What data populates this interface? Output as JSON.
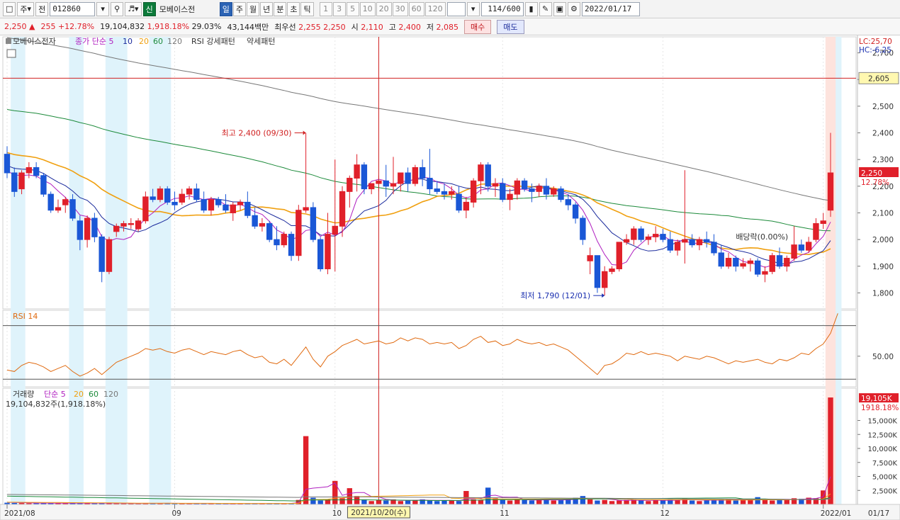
{
  "toolbar": {
    "mode_label": "주",
    "prev_label": "전",
    "code": "012860",
    "credit_badge": "신",
    "stock_name": "모베이스전",
    "periods": [
      "일",
      "주",
      "월",
      "년",
      "분",
      "초",
      "틱"
    ],
    "active_period": "일",
    "intervals": [
      "1",
      "3",
      "5",
      "10",
      "20",
      "30",
      "60",
      "120"
    ],
    "count_value": "114",
    "count_max": "/600",
    "date": "2022/01/17"
  },
  "quote": {
    "price": "2,250",
    "arrow": "▲",
    "change": "255",
    "change_pct": "+12.78%",
    "volume": "19,104,832",
    "volume_ratio": "1,918.18%",
    "turnover": "29.03%",
    "amount": "43,144백만",
    "best_label": "최우선",
    "best_ask": "2,255",
    "best_bid": "2,250",
    "open_label": "시",
    "open": "2,110",
    "high_label": "고",
    "high": "2,400",
    "low_label": "저",
    "low": "2,085",
    "buy_label": "매수",
    "sell_label": "매도"
  },
  "price_panel": {
    "legend": {
      "name": "모베이스전자",
      "ma_label": "종가 단순",
      "ma_periods": [
        "5",
        "10",
        "20",
        "60",
        "120"
      ],
      "rsi_pattern": "RSI 강세패턴",
      "weak_pattern": "약세패턴"
    },
    "lc": "LC:25,70",
    "hc": "HC:-6,25",
    "high_marker": "최고 2,400 (09/30)",
    "low_marker": "최저 1,790 (12/01)",
    "dividend_marker": "배당락(0.00%)",
    "h_line_label": "2,605",
    "current_label": "2,250",
    "current_pct": "12.78%",
    "y_ticks": [
      "2,700",
      "2,600",
      "2,500",
      "2,400",
      "2,300",
      "2,200",
      "2,100",
      "2,000",
      "1,900",
      "1,800"
    ]
  },
  "rsi_panel": {
    "title": "RSI 14",
    "y_tick": "50.00"
  },
  "volume_panel": {
    "legend_title": "거래량",
    "ma_label": "단순",
    "ma_periods": [
      "5",
      "20",
      "60",
      "120"
    ],
    "summary": "19,104,832주(1,918.18%)",
    "current_label": "19,105K",
    "current_pct": "1918.18%",
    "y_ticks": [
      "15,000K",
      "12,500K",
      "10,000K",
      "7,500K",
      "5,000K",
      "2,500K"
    ]
  },
  "x_axis": {
    "labels": [
      "2021/08",
      "09",
      "10",
      "11",
      "12",
      "2022/01"
    ],
    "cursor_label": "2021/10/20(수)",
    "right_label": "01/17"
  },
  "colors": {
    "up": "#e0202a",
    "down": "#1a57d6",
    "ma5": "#b020c0",
    "ma10": "#1a2a9c",
    "ma20": "#f0a010",
    "ma60": "#1c8a3a",
    "ma120": "#777777"
  },
  "chart_data": {
    "type": "candlestick",
    "ylim": [
      1740,
      2760
    ],
    "candles": [
      [
        2320,
        2350,
        2230,
        2250
      ],
      [
        2250,
        2270,
        2160,
        2180
      ],
      [
        2190,
        2260,
        2170,
        2250
      ],
      [
        2250,
        2290,
        2230,
        2270
      ],
      [
        2270,
        2290,
        2230,
        2240
      ],
      [
        2240,
        2250,
        2160,
        2170
      ],
      [
        2170,
        2180,
        2100,
        2110
      ],
      [
        2110,
        2150,
        2100,
        2120
      ],
      [
        2130,
        2160,
        2100,
        2150
      ],
      [
        2150,
        2170,
        2070,
        2080
      ],
      [
        2070,
        2090,
        1960,
        2000
      ],
      [
        2000,
        2090,
        1970,
        2080
      ],
      [
        2080,
        2100,
        1990,
        2010
      ],
      [
        2010,
        2020,
        1840,
        1880
      ],
      [
        1880,
        2010,
        1870,
        2000
      ],
      [
        2030,
        2060,
        2010,
        2050
      ],
      [
        2050,
        2070,
        2030,
        2060
      ],
      [
        2060,
        2080,
        2040,
        2060
      ],
      [
        2040,
        2080,
        2030,
        2070
      ],
      [
        2070,
        2180,
        2060,
        2160
      ],
      [
        2160,
        2190,
        2140,
        2150
      ],
      [
        2150,
        2200,
        2140,
        2190
      ],
      [
        2190,
        2200,
        2130,
        2140
      ],
      [
        2140,
        2180,
        2110,
        2130
      ],
      [
        2140,
        2190,
        2130,
        2170
      ],
      [
        2170,
        2200,
        2150,
        2190
      ],
      [
        2190,
        2210,
        2140,
        2150
      ],
      [
        2150,
        2180,
        2100,
        2110
      ],
      [
        2110,
        2160,
        2090,
        2150
      ],
      [
        2150,
        2160,
        2120,
        2130
      ],
      [
        2130,
        2170,
        2100,
        2110
      ],
      [
        2100,
        2140,
        2070,
        2130
      ],
      [
        2130,
        2150,
        2110,
        2140
      ],
      [
        2140,
        2180,
        2080,
        2090
      ],
      [
        2090,
        2120,
        2040,
        2050
      ],
      [
        2050,
        2080,
        2030,
        2060
      ],
      [
        2060,
        2070,
        1990,
        2000
      ],
      [
        2000,
        2050,
        1960,
        1980
      ],
      [
        1980,
        2030,
        1970,
        2020
      ],
      [
        2020,
        2030,
        1920,
        1940
      ],
      [
        1940,
        2130,
        1920,
        2110
      ],
      [
        2110,
        2400,
        2100,
        2120
      ],
      [
        2120,
        2140,
        1990,
        2000
      ],
      [
        2000,
        2010,
        1880,
        1890
      ],
      [
        1890,
        2100,
        1870,
        2020
      ],
      [
        2020,
        2300,
        1880,
        2050
      ],
      [
        2050,
        2200,
        2010,
        2180
      ],
      [
        2180,
        2240,
        2120,
        2230
      ],
      [
        2230,
        2320,
        2180,
        2280
      ],
      [
        2280,
        2290,
        2170,
        2190
      ],
      [
        2190,
        2210,
        2170,
        2210
      ],
      [
        2210,
        2240,
        2180,
        2220
      ],
      [
        2220,
        2280,
        2160,
        2200
      ],
      [
        2200,
        2310,
        2170,
        2210
      ],
      [
        2210,
        2250,
        2180,
        2250
      ],
      [
        2250,
        2270,
        2180,
        2210
      ],
      [
        2210,
        2280,
        2200,
        2270
      ],
      [
        2270,
        2300,
        2200,
        2230
      ],
      [
        2230,
        2340,
        2170,
        2190
      ],
      [
        2190,
        2220,
        2170,
        2180
      ],
      [
        2180,
        2210,
        2150,
        2170
      ],
      [
        2170,
        2200,
        2150,
        2180
      ],
      [
        2170,
        2200,
        2100,
        2110
      ],
      [
        2110,
        2160,
        2080,
        2140
      ],
      [
        2140,
        2230,
        2120,
        2220
      ],
      [
        2220,
        2290,
        2170,
        2280
      ],
      [
        2280,
        2290,
        2180,
        2200
      ],
      [
        2200,
        2230,
        2160,
        2210
      ],
      [
        2210,
        2230,
        2140,
        2150
      ],
      [
        2150,
        2190,
        2110,
        2170
      ],
      [
        2170,
        2230,
        2150,
        2220
      ],
      [
        2220,
        2230,
        2180,
        2190
      ],
      [
        2190,
        2210,
        2140,
        2180
      ],
      [
        2180,
        2210,
        2160,
        2200
      ],
      [
        2200,
        2230,
        2150,
        2170
      ],
      [
        2170,
        2200,
        2160,
        2190
      ],
      [
        2190,
        2200,
        2140,
        2150
      ],
      [
        2150,
        2170,
        2110,
        2130
      ],
      [
        2130,
        2140,
        2060,
        2080
      ],
      [
        2080,
        2090,
        1980,
        2000
      ],
      [
        1920,
        1970,
        1870,
        1940
      ],
      [
        1940,
        1940,
        1800,
        1820
      ],
      [
        1820,
        1900,
        1790,
        1880
      ],
      [
        1880,
        1900,
        1870,
        1890
      ],
      [
        1890,
        1990,
        1880,
        1990
      ],
      [
        1990,
        2020,
        1980,
        2000
      ],
      [
        2000,
        2050,
        1980,
        2040
      ],
      [
        2040,
        2050,
        1990,
        2000
      ],
      [
        2000,
        2020,
        1980,
        2010
      ],
      [
        2010,
        2050,
        1990,
        2020
      ],
      [
        2020,
        2040,
        1990,
        2000
      ],
      [
        2000,
        2030,
        1950,
        1960
      ],
      [
        1960,
        2000,
        1940,
        1990
      ],
      [
        1990,
        2260,
        1910,
        2000
      ],
      [
        2000,
        2020,
        1970,
        1980
      ],
      [
        1980,
        2010,
        1960,
        2000
      ],
      [
        2000,
        2030,
        1970,
        1990
      ],
      [
        1990,
        2020,
        1940,
        1950
      ],
      [
        1950,
        1980,
        1890,
        1900
      ],
      [
        1900,
        1950,
        1890,
        1930
      ],
      [
        1930,
        1940,
        1880,
        1900
      ],
      [
        1900,
        1930,
        1890,
        1910
      ],
      [
        1910,
        1930,
        1880,
        1920
      ],
      [
        1920,
        1930,
        1860,
        1870
      ],
      [
        1870,
        1900,
        1840,
        1880
      ],
      [
        1880,
        1950,
        1870,
        1940
      ],
      [
        1940,
        1970,
        1890,
        1900
      ],
      [
        1900,
        1940,
        1880,
        1930
      ],
      [
        1930,
        2050,
        1920,
        1980
      ],
      [
        1980,
        2000,
        1950,
        1960
      ],
      [
        1960,
        2010,
        1950,
        1990
      ],
      [
        2000,
        2080,
        1990,
        2060
      ],
      [
        2060,
        2100,
        2040,
        2070
      ],
      [
        2110,
        2400,
        2085,
        2250
      ]
    ],
    "rsi": [
      41,
      40,
      44,
      46,
      45,
      43,
      40,
      42,
      44,
      40,
      37,
      39,
      42,
      38,
      42,
      46,
      48,
      50,
      52,
      55,
      54,
      55,
      53,
      52,
      54,
      55,
      53,
      51,
      53,
      52,
      51,
      53,
      54,
      51,
      49,
      50,
      46,
      45,
      48,
      44,
      50,
      56,
      48,
      43,
      50,
      53,
      57,
      59,
      61,
      58,
      59,
      60,
      58,
      59,
      62,
      60,
      62,
      61,
      58,
      59,
      58,
      59,
      55,
      57,
      61,
      63,
      59,
      60,
      57,
      58,
      61,
      59,
      58,
      59,
      57,
      58,
      56,
      54,
      50,
      46,
      42,
      38,
      44,
      45,
      48,
      52,
      51,
      53,
      51,
      52,
      51,
      50,
      47,
      50,
      49,
      48,
      50,
      49,
      47,
      45,
      47,
      46,
      47,
      48,
      46,
      45,
      48,
      47,
      49,
      52,
      51,
      55,
      58,
      65,
      78
    ],
    "volume": [
      300,
      260,
      240,
      220,
      210,
      250,
      230,
      200,
      190,
      220,
      260,
      220,
      200,
      260,
      210,
      180,
      170,
      160,
      170,
      260,
      200,
      180,
      190,
      170,
      180,
      190,
      170,
      160,
      180,
      170,
      160,
      170,
      180,
      200,
      170,
      160,
      200,
      190,
      170,
      210,
      800,
      12200,
      1200,
      700,
      900,
      4200,
      1100,
      2900,
      1500,
      900,
      600,
      800,
      700,
      900,
      600,
      700,
      800,
      900,
      700,
      600,
      650,
      700,
      600,
      2400,
      900,
      800,
      3000,
      1100,
      800,
      700,
      900,
      800,
      700,
      800,
      900,
      700,
      800,
      900,
      1200,
      1500,
      900,
      700,
      800,
      600,
      700,
      800,
      900,
      700,
      600,
      800,
      700,
      900,
      800,
      1000,
      700,
      600,
      700,
      800,
      900,
      1000,
      700,
      900,
      800,
      1300,
      900,
      700,
      800,
      900,
      1100,
      1000,
      1200,
      1100,
      2500,
      19105
    ]
  }
}
